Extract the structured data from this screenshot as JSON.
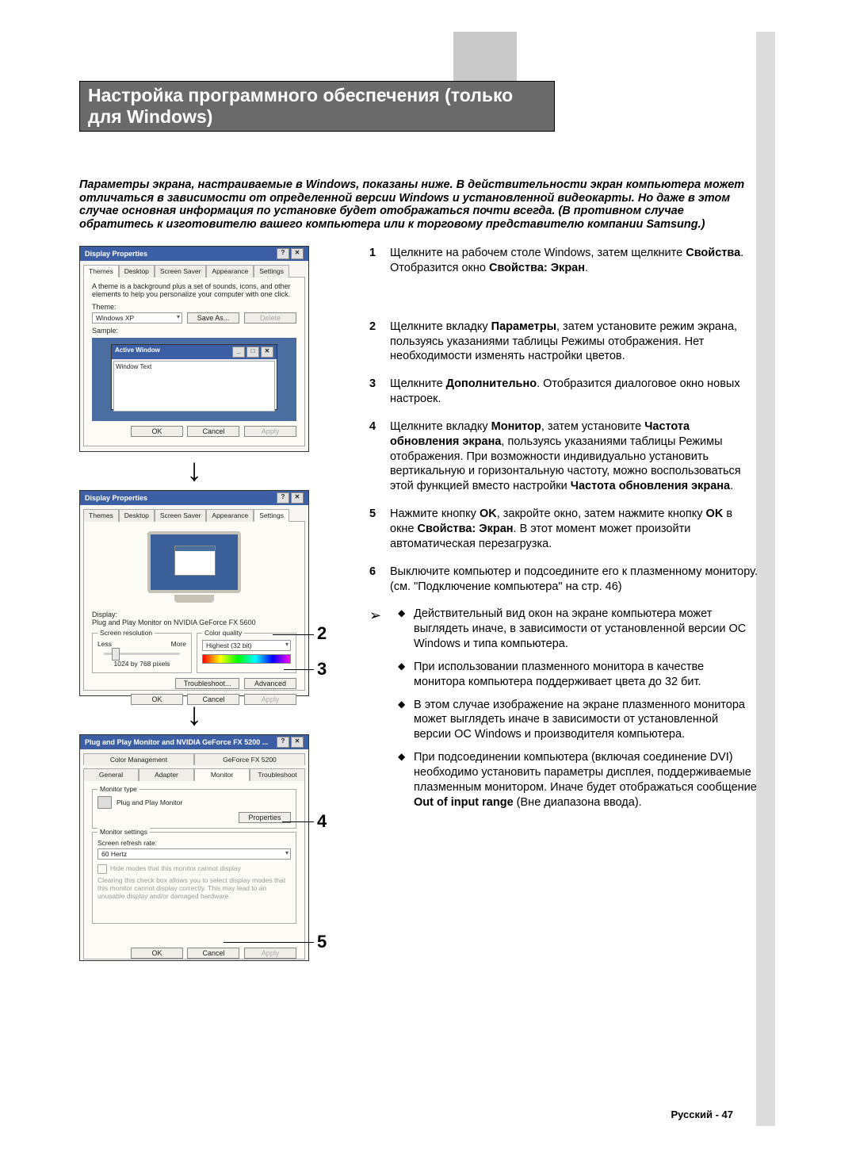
{
  "page_title": "Настройка программного обеспечения (только для Windows)",
  "intro": "Параметры экрана, настраиваемые в Windows, показаны ниже. В действительности экран компьютера может отличаться в зависимости от определенной версии Windows и установленной видеокарты. Но даже в этом случае основная информация по установке будет отображаться почти всегда. (В противном случае обратитесь к изготовителю вашего компьютера или к торговому представителю компании Samsung.)",
  "dialog1": {
    "title": "Display Properties",
    "tabs": [
      "Themes",
      "Desktop",
      "Screen Saver",
      "Appearance",
      "Settings"
    ],
    "active_tab_index": 0,
    "desc": "A theme is a background plus a set of sounds, icons, and other elements to help you personalize your computer with one click.",
    "theme_label": "Theme:",
    "theme_value": "Windows XP",
    "save_as": "Save As...",
    "delete": "Delete",
    "sample_label": "Sample:",
    "aw_title": "Active Window",
    "aw_text": "Window Text",
    "ok": "OK",
    "cancel": "Cancel",
    "apply": "Apply"
  },
  "dialog2": {
    "title": "Display Properties",
    "tabs": [
      "Themes",
      "Desktop",
      "Screen Saver",
      "Appearance",
      "Settings"
    ],
    "active_tab_index": 4,
    "display_label": "Display:",
    "display_value": "Plug and Play Monitor on NVIDIA GeForce FX 5600",
    "res_legend": "Screen resolution",
    "less": "Less",
    "more": "More",
    "res_value": "1024 by 768 pixels",
    "cq_legend": "Color quality",
    "cq_value": "Highest (32 bit)",
    "troubleshoot": "Troubleshoot...",
    "advanced": "Advanced",
    "ok": "OK",
    "cancel": "Cancel",
    "apply": "Apply"
  },
  "dialog3": {
    "title": "Plug and Play Monitor and NVIDIA GeForce FX 5200 ...",
    "tabs_row1": [
      "Color Management",
      "GeForce FX 5200"
    ],
    "tabs_row2": [
      "General",
      "Adapter",
      "Monitor",
      "Troubleshoot"
    ],
    "active_tab_label": "Monitor",
    "mt_legend": "Monitor type",
    "mt_value": "Plug and Play Monitor",
    "properties": "Properties",
    "ms_legend": "Monitor settings",
    "refresh_label": "Screen refresh rate:",
    "refresh_value": "60 Hertz",
    "hide_check": "Hide modes that this monitor cannot display",
    "hide_desc": "Clearing this check box allows you to select display modes that this monitor cannot display correctly. This may lead to an unusable display and/or damaged hardware.",
    "ok": "OK",
    "cancel": "Cancel",
    "apply": "Apply"
  },
  "callouts": {
    "c2": "2",
    "c3": "3",
    "c4": "4",
    "c5": "5"
  },
  "steps": {
    "s1_num": "1",
    "s1_a": "Щелкните на рабочем столе Windows, затем щелкните ",
    "s1_b": "Свойства",
    "s1_c": ".",
    "s1_d": "Отобразится окно ",
    "s1_e": "Свойства: Экран",
    "s1_f": ".",
    "s2_num": "2",
    "s2_a": "Щелкните вкладку ",
    "s2_b": "Параметры",
    "s2_c": ", затем установите режим экрана, пользуясь указаниями таблицы Режимы отображения. Нет необходимости изменять настройки цветов.",
    "s3_num": "3",
    "s3_a": "Щелкните ",
    "s3_b": "Дополнительно",
    "s3_c": ". Отобразится диалоговое окно новых настроек.",
    "s4_num": "4",
    "s4_a": "Щелкните вкладку ",
    "s4_b": "Монитор",
    "s4_c": ", затем установите ",
    "s4_d": "Частота обновления экрана",
    "s4_e": ", пользуясь указаниями таблицы Режимы отображения. При возможности индивидуально установить вертикальную и горизонтальную частоту, можно воспользоваться этой функцией вместо настройки ",
    "s4_f": "Частота обновления экрана",
    "s4_g": ".",
    "s5_num": "5",
    "s5_a": "Нажмите кнопку ",
    "s5_b": "OK",
    "s5_c": ", закройте окно, затем нажмите кнопку ",
    "s5_d": "OK",
    "s5_e": " в окне ",
    "s5_f": "Свойства: Экран",
    "s5_g": ". В этот момент может произойти автоматическая перезагрузка.",
    "s6_num": "6",
    "s6_a": "Выключите компьютер и подсоедините его к плазменному монитору. (см. \"Подключение компьютера\" на стр. 46)"
  },
  "notes": {
    "n1": "Действительный вид окон на экране компьютера может выглядеть иначе, в зависимости от установленной версии ОС Windows и типа компьютера.",
    "n2": "При использовании плазменного монитора в качестве монитора компьютера поддерживает цвета до 32 бит.",
    "n3": "В этом случае изображение на экране плазменного монитора может выглядеть иначе в зависимости от установленной версии ОС Windows и производителя компьютера.",
    "n4_a": "При подсоединении компьютера (включая соединение DVI) необходимо установить параметры дисплея, поддерживаемые плазменным монитором. Иначе будет отображаться сообщение ",
    "n4_b": "Out of input range",
    "n4_c": " (Вне диапазона ввода)."
  },
  "footer": "Русский - 47"
}
